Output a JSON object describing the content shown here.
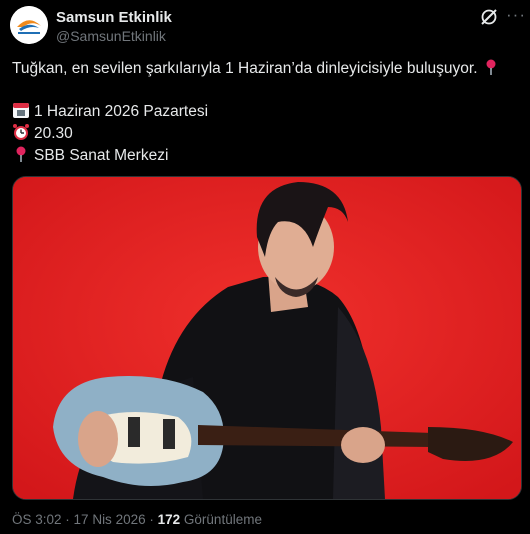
{
  "author": {
    "name": "Samsun Etkinlik",
    "handle": "@SamsunEtkinlik"
  },
  "tweet": {
    "line1": "Tuğkan, en sevilen şarkılarıyla 1 Haziran’da dinleyicisiyle buluşuyor.",
    "date_line": "1 Haziran 2026 Pazartesi",
    "time_line": "20.30",
    "place_line": "SBB Sanat Merkezi"
  },
  "icons": [
    "grok-icon",
    "more-icon",
    "pin-icon",
    "calendar-icon",
    "alarm-clock-icon"
  ],
  "meta": {
    "time": "ÖS 3:02",
    "date": "17 Nis 2026",
    "views_count": "172",
    "views_label": "Görüntüleme"
  },
  "colors": {
    "media_bg": "#e51f1f",
    "muted": "#71767b",
    "text": "#e7e9ea"
  }
}
